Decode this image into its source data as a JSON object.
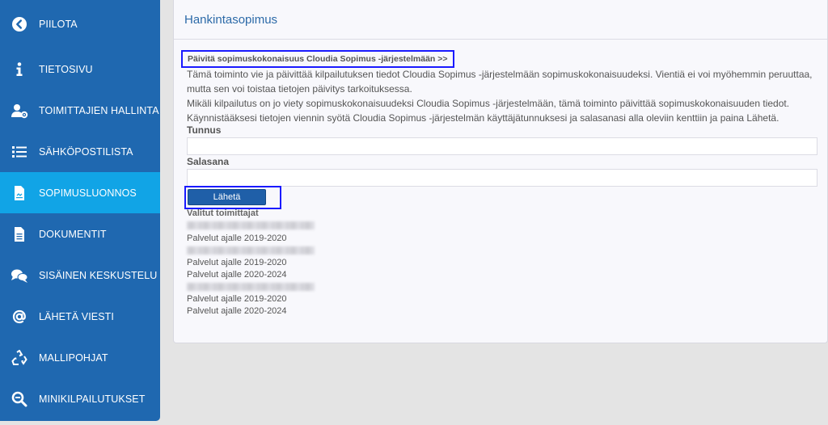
{
  "sidebar": {
    "items": [
      {
        "label": "PIILOTA",
        "icon": "chevron-left-circle-icon"
      },
      {
        "label": "TIETOSIVU",
        "icon": "info-icon"
      },
      {
        "label": "TOIMITTAJIEN HALLINTA",
        "icon": "user-gear-icon"
      },
      {
        "label": "SÄHKÖPOSTILISTA",
        "icon": "list-icon"
      },
      {
        "label": "SOPIMUSLUONNOS",
        "icon": "contract-document-icon"
      },
      {
        "label": "DOKUMENTIT",
        "icon": "document-icon"
      },
      {
        "label": "SISÄINEN KESKUSTELU",
        "icon": "chat-icon"
      },
      {
        "label": "LÄHETÄ VIESTI",
        "icon": "at-sign-icon"
      },
      {
        "label": "MALLIPOHJAT",
        "icon": "recycle-icon"
      },
      {
        "label": "MINIKILPAILUTUKSET",
        "icon": "search-minus-icon"
      }
    ],
    "active_index": 4,
    "colors": {
      "background": "#1f68b0",
      "active": "#11a4e6"
    }
  },
  "main": {
    "title": "Hankintasopimus",
    "update_link": "Päivitä sopimuskokonaisuus Cloudia Sopimus -järjestelmään >>",
    "description": [
      "Tämä toiminto vie ja päivittää kilpailutuksen tiedot Cloudia Sopimus -järjestelmään sopimuskokonaisuudeksi. Vientiä ei voi myöhemmin peruuttaa, mutta sen voi toistaa tietojen päivitys tarkoituksessa.",
      "Mikäli kilpailutus on jo viety sopimuskokonaisuudeksi Cloudia Sopimus -järjestelmään, tämä toiminto päivittää sopimuskokonaisuuden tiedot.",
      "Käynnistääksesi tietojen viennin syötä Cloudia Sopimus -järjestelmän käyttäjätunnuksesi ja salasanasi alla oleviin kenttiin ja paina Lähetä."
    ],
    "username_label": "Tunnus",
    "username_value": "",
    "password_label": "Salasana",
    "password_value": "",
    "send_button": "Lähetä",
    "suppliers_label": "Valitut toimittajat",
    "suppliers": [
      {
        "services": [
          "Palvelut ajalle 2019-2020"
        ]
      },
      {
        "services": [
          "Palvelut ajalle 2019-2020",
          "Palvelut ajalle 2020-2024"
        ]
      },
      {
        "services": [
          "Palvelut ajalle 2019-2020",
          "Palvelut ajalle 2020-2024"
        ]
      }
    ]
  }
}
